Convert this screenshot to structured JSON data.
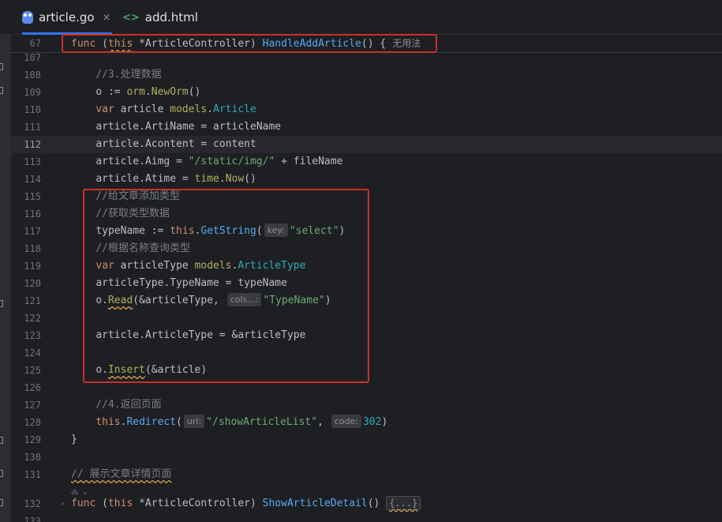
{
  "tabs": [
    {
      "label": "article.go",
      "active": true,
      "close": "×"
    },
    {
      "label": "add.html",
      "active": false
    }
  ],
  "icons": {
    "go_file": "gopher-icon",
    "html_file": "html-file-icon",
    "html_glyph": "<>"
  },
  "sticky": {
    "line": "67",
    "keyword": "func",
    "receiver_open": " (",
    "this": "this",
    "receiver_type": " *ArticleController",
    "receiver_close": ") ",
    "name": "HandleAddArticle",
    "rest": "() {",
    "usages": "无用法"
  },
  "lines": {
    "l107": "107",
    "l108": "108",
    "l109": "109",
    "l110": "110",
    "l111": "111",
    "l112": "112",
    "l113": "113",
    "l114": "114",
    "l115": "115",
    "l116": "116",
    "l117": "117",
    "l118": "118",
    "l119": "119",
    "l120": "120",
    "l121": "121",
    "l122": "122",
    "l123": "123",
    "l124": "124",
    "l125": "125",
    "l126": "126",
    "l127": "127",
    "l128": "128",
    "l129": "129",
    "l130": "130",
    "l131": "131",
    "l132": "132",
    "l133": "133"
  },
  "code": {
    "c108": "//3.处理数据",
    "c109_a": "o := ",
    "c109_b": "orm",
    "c109_c": ".",
    "c109_d": "NewOrm",
    "c109_e": "()",
    "c110_a": "var",
    "c110_b": " article ",
    "c110_c": "models",
    "c110_d": ".",
    "c110_e": "Article",
    "c111_a": "article.",
    "c111_b": "ArtiName",
    "c111_c": " = articleName",
    "c112_a": "article.",
    "c112_b": "Acontent",
    "c112_c": " = content",
    "c113_a": "article.",
    "c113_b": "Aimg",
    "c113_c": " = ",
    "c113_d": "\"/static/img/\"",
    "c113_e": " + fileName",
    "c114_a": "article.",
    "c114_b": "Atime",
    "c114_c": " = ",
    "c114_d": "time",
    "c114_e": ".",
    "c114_f": "Now",
    "c114_g": "()",
    "c115": "//给文章添加类型",
    "c116": "//获取类型数据",
    "c117_a": "typeName := ",
    "c117_b": "this",
    "c117_c": ".",
    "c117_d": "GetString",
    "c117_e": "(",
    "c117_hint": "key:",
    "c117_f": "\"select\"",
    "c117_g": ")",
    "c118": "//根据名称查询类型",
    "c119_a": "var",
    "c119_b": " articleType ",
    "c119_c": "models",
    "c119_d": ".",
    "c119_e": "ArticleType",
    "c120_a": "articleType.",
    "c120_b": "TypeName",
    "c120_c": " = typeName",
    "c121_a": "o.",
    "c121_b": "Read",
    "c121_c": "(&articleType, ",
    "c121_hint": "cols...:",
    "c121_d": "\"TypeName\"",
    "c121_e": ")",
    "c123_a": "article.",
    "c123_b": "ArticleType",
    "c123_c": " = &articleType",
    "c125_a": "o.",
    "c125_b": "Insert",
    "c125_c": "(&article)",
    "c127": "//4.返回页面",
    "c128_a": "this",
    "c128_b": ".",
    "c128_c": "Redirect",
    "c128_d": "(",
    "c128_hint1": "url:",
    "c128_e": "\"/showArticleList\"",
    "c128_f": ", ",
    "c128_hint2": "code:",
    "c128_g": "302",
    "c128_h": ")",
    "c129": "}",
    "c131": "// 展示文章详情页面",
    "c131_author": "🝆 ⌄",
    "c132_a": "func",
    "c132_b": " (",
    "c132_c": "this",
    "c132_d": " *ArticleController) ",
    "c132_e": "ShowArticleDetail",
    "c132_f": "() ",
    "c132_fold": "{...}"
  },
  "fold_glyph": "›"
}
